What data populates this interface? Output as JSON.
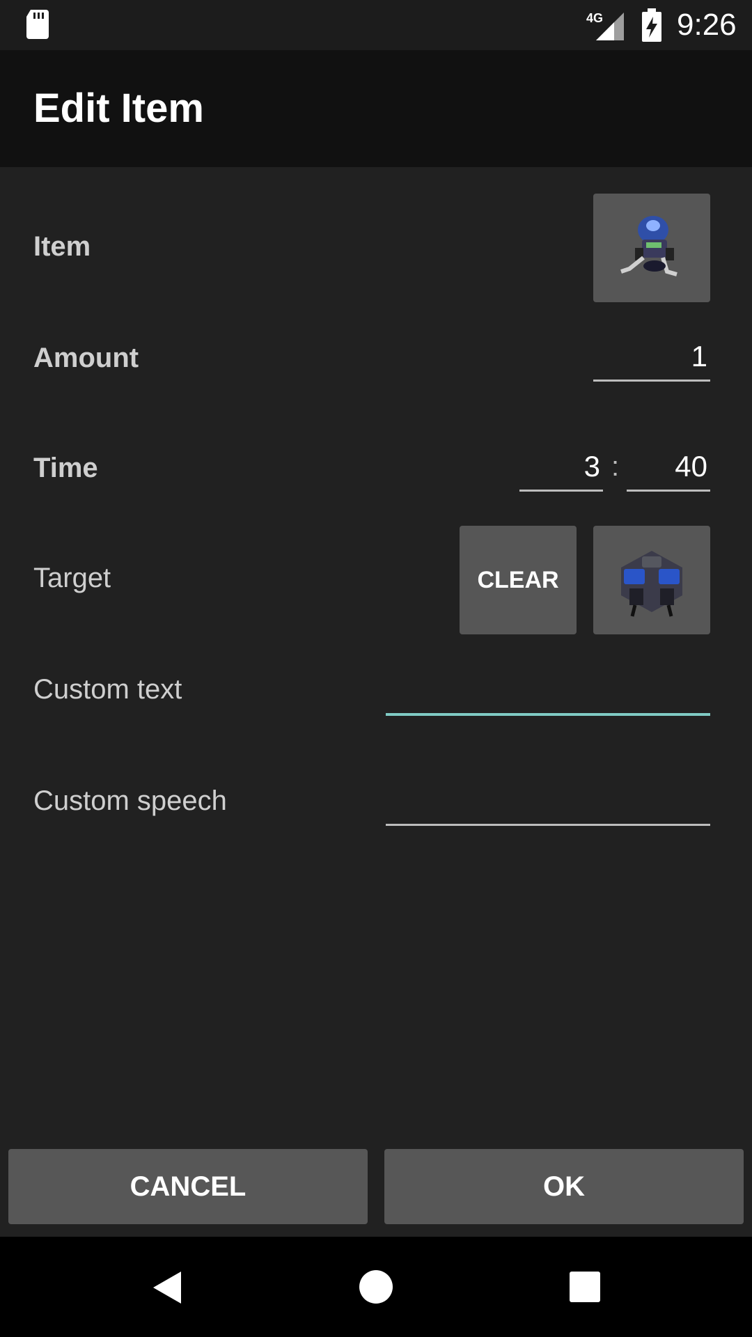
{
  "status_bar": {
    "time": "9:26",
    "network": "4G",
    "icons": [
      "sd-card-icon",
      "signal-icon",
      "battery-charging-icon"
    ]
  },
  "app_bar": {
    "title": "Edit Item"
  },
  "form": {
    "item_label": "Item",
    "amount_label": "Amount",
    "amount_value": "1",
    "time_label": "Time",
    "time_minutes": "3",
    "time_separator": ":",
    "time_seconds": "40",
    "target_label": "Target",
    "clear_label": "CLEAR",
    "custom_text_label": "Custom text",
    "custom_text_value": "",
    "custom_speech_label": "Custom speech",
    "custom_speech_value": ""
  },
  "actions": {
    "cancel_label": "CANCEL",
    "ok_label": "OK"
  },
  "nav": {
    "icons": [
      "back-icon",
      "home-icon",
      "recents-icon"
    ]
  },
  "colors": {
    "background": "#212121",
    "app_bar": "#111111",
    "button": "#575757",
    "focus_accent": "#80cbc4"
  }
}
